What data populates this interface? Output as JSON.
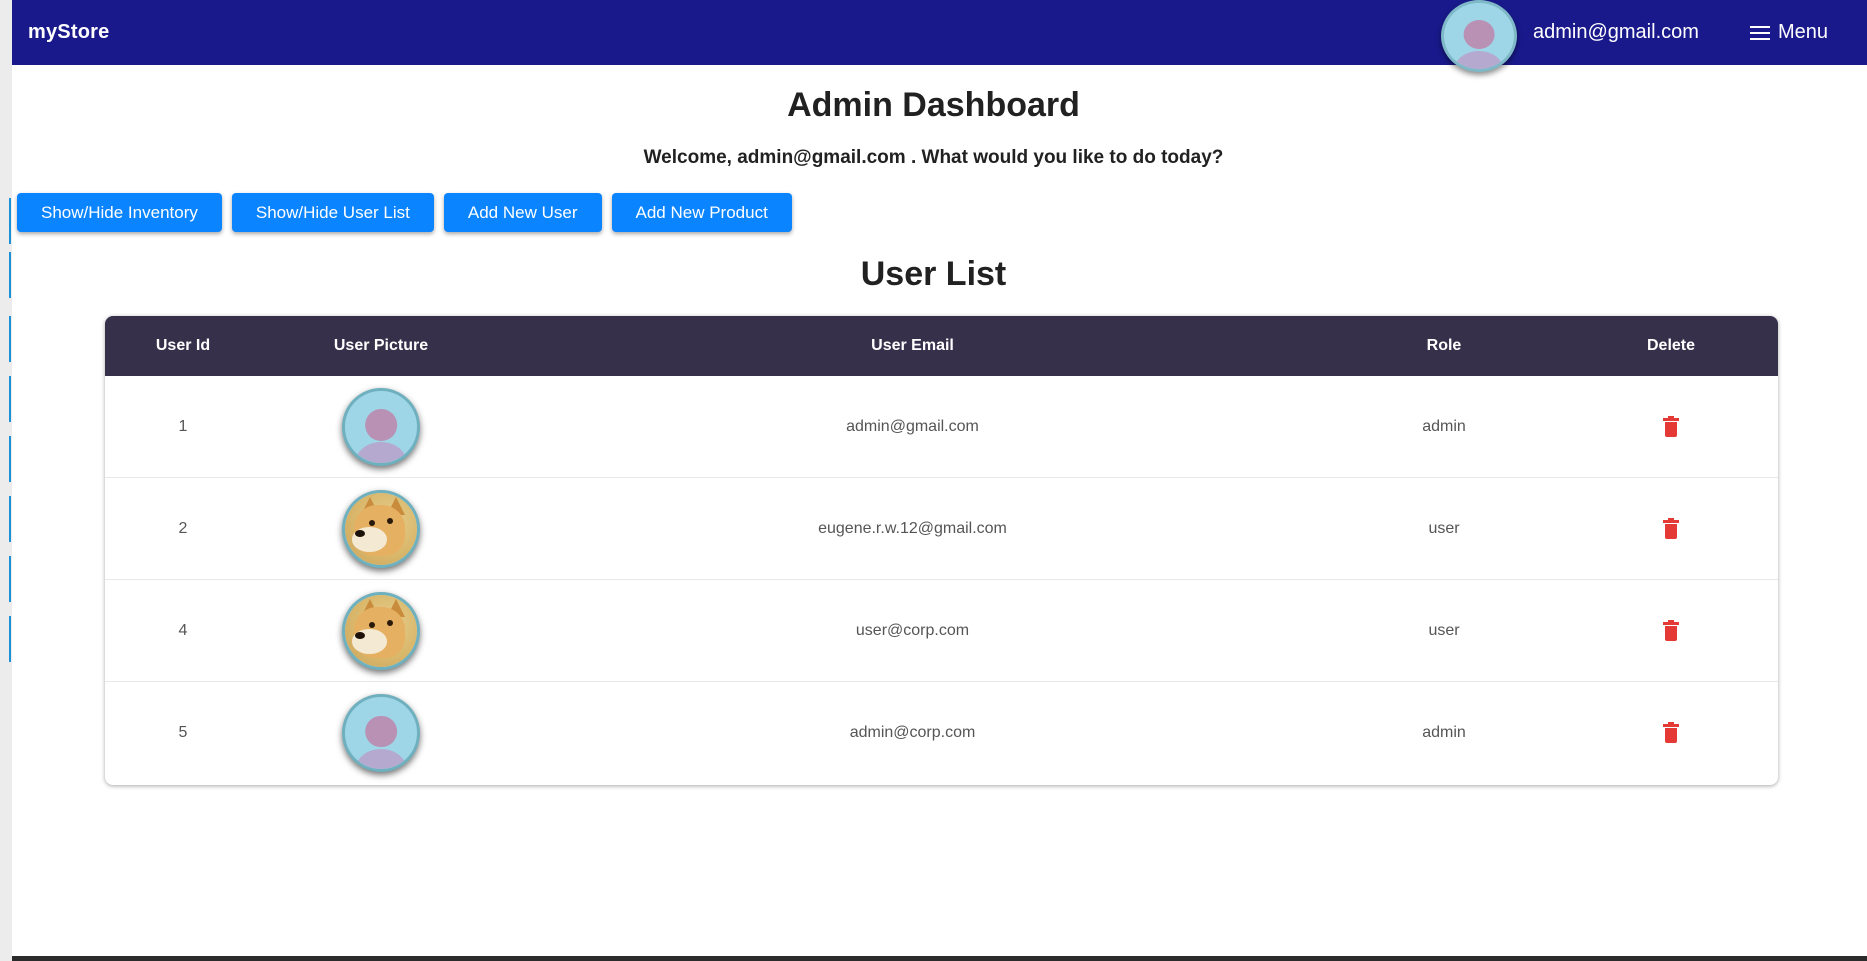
{
  "navbar": {
    "brand": "myStore",
    "user_email": "admin@gmail.com",
    "menu_label": "Menu",
    "avatar_icon": "default-user-avatar",
    "background": "#19198c"
  },
  "page": {
    "title": "Admin Dashboard",
    "welcome": "Welcome, admin@gmail.com . What would you like to do today?"
  },
  "actions": {
    "show_hide_inventory": "Show/Hide Inventory",
    "show_hide_user_list": "Show/Hide User List",
    "add_new_user": "Add New User",
    "add_new_product": "Add New Product",
    "button_color": "#0a84ff"
  },
  "user_list": {
    "title": "User List",
    "columns": [
      "User Id",
      "User Picture",
      "User Email",
      "Role",
      "Delete"
    ],
    "header_color": "#36304b",
    "rows": [
      {
        "id": "1",
        "picture": "default-user-avatar",
        "email": "admin@gmail.com",
        "role": "admin",
        "delete_icon": "trash-icon"
      },
      {
        "id": "2",
        "picture": "doge-photo",
        "email": "eugene.r.w.12@gmail.com",
        "role": "user",
        "delete_icon": "trash-icon"
      },
      {
        "id": "4",
        "picture": "doge-photo",
        "email": "user@corp.com",
        "role": "user",
        "delete_icon": "trash-icon"
      },
      {
        "id": "5",
        "picture": "default-user-avatar",
        "email": "admin@corp.com",
        "role": "admin",
        "delete_icon": "trash-icon"
      }
    ],
    "delete_color": "#e53935"
  }
}
